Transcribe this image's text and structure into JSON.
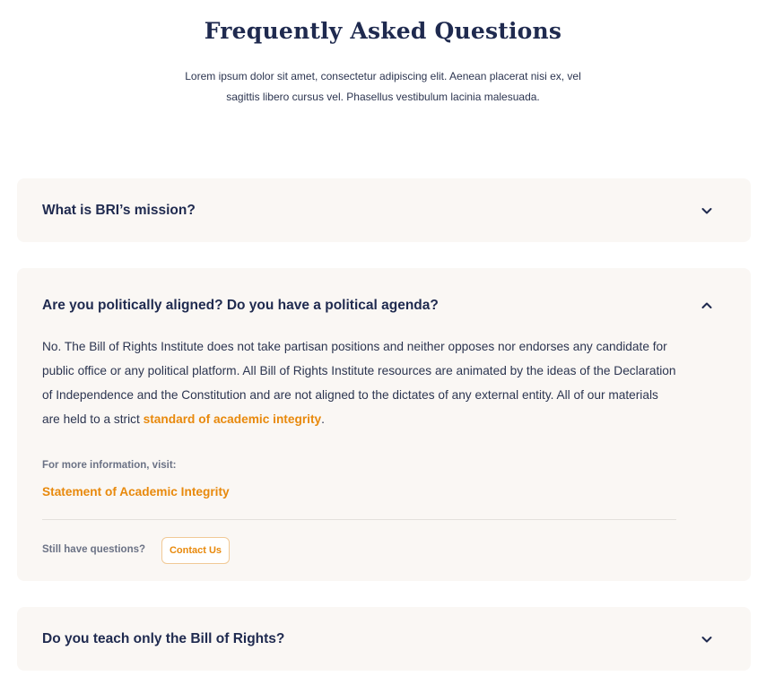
{
  "header": {
    "title": "Frequently Asked Questions",
    "subtitle": "Lorem ipsum dolor sit amet, consectetur adipiscing elit. Aenean placerat nisi ex, vel sagittis libero cursus vel. Phasellus vestibulum lacinia malesuada."
  },
  "faq": [
    {
      "question": "What is BRI’s mission?",
      "expanded": false,
      "icon": "chevron-down-icon"
    },
    {
      "question": "Are you politically aligned? Do you have a political agenda?",
      "expanded": true,
      "icon": "chevron-up-icon",
      "answer_text": "No. The Bill of Rights Institute does not take partisan positions and neither opposes nor endorses any candidate for public office or any political platform. All Bill of Rights Institute resources are animated by the ideas of the Declaration of Independence and the Constitution and are not aligned to the dictates of any external entity. All of our materials are held to a strict ",
      "answer_link": "standard of academic integrity",
      "answer_end": ".",
      "more_label": "For more information, visit:",
      "more_link": "Statement of Academic Integrity",
      "still_label": "Still have questions?",
      "contact_label": "Contact Us"
    },
    {
      "question": "Do you teach only the Bill of Rights?",
      "expanded": false,
      "icon": "chevron-down-icon"
    }
  ],
  "colors": {
    "heading": "#1f2a4f",
    "accent": "#e8890c",
    "card_bg": "#faf7f4",
    "muted": "#6b7285"
  }
}
